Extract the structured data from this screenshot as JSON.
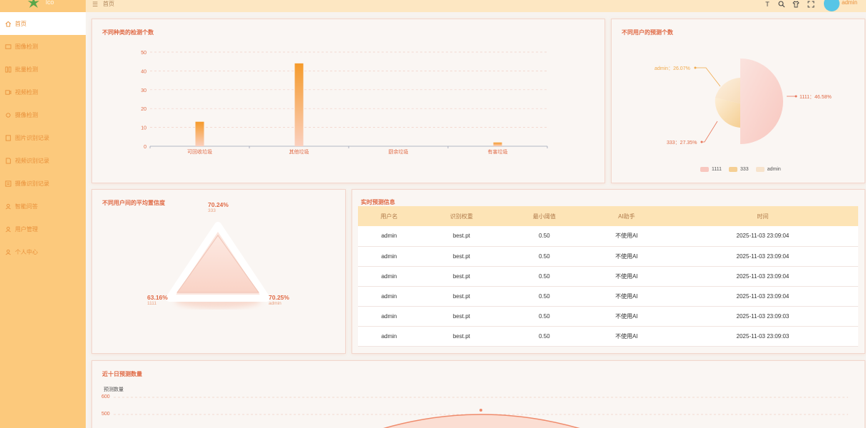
{
  "app": {
    "logo_text": "lco"
  },
  "sidebar": {
    "items": [
      {
        "label": "首页"
      },
      {
        "label": "图像检测"
      },
      {
        "label": "批量检测"
      },
      {
        "label": "视频检测"
      },
      {
        "label": "摄像检测"
      },
      {
        "label": "图片识别记录"
      },
      {
        "label": "视频识别记录"
      },
      {
        "label": "摄像识别记录"
      },
      {
        "label": "智能问答"
      },
      {
        "label": "用户管理"
      },
      {
        "label": "个人中心"
      }
    ]
  },
  "header": {
    "breadcrumb": "首页",
    "username": "admin",
    "icons": [
      "font-size-icon",
      "search-icon",
      "shirt-icon",
      "fullscreen-icon"
    ]
  },
  "colors": {
    "accent": "#e06a45",
    "sidebar": "#fcc97c",
    "header": "#fde7c2"
  },
  "panels": {
    "bar_title": "不同种类的检测个数",
    "pie_title": "不同用户的预测个数",
    "radar_title": "不同用户间的平均置信度",
    "table_title": "实时预测信息",
    "line_title": "近十日预测数量"
  },
  "chart_data": [
    {
      "type": "bar",
      "categories": [
        "可回收垃圾",
        "其他垃圾",
        "厨余垃圾",
        "有害垃圾"
      ],
      "values": [
        13,
        44,
        0,
        2
      ],
      "ylim": [
        0,
        50
      ],
      "yticks": [
        "0",
        "10",
        "20",
        "30",
        "40",
        "50"
      ],
      "grid": true
    },
    {
      "type": "pie",
      "slices": [
        {
          "name": "1111",
          "value": 46.58,
          "label": "1111：46.58%"
        },
        {
          "name": "333",
          "value": 27.35,
          "label": "333：27.35%"
        },
        {
          "name": "admin",
          "value": 26.07,
          "label": "admin：26.07%"
        }
      ],
      "legend": [
        "1111",
        "333",
        "admin"
      ],
      "legend_placement": "bottom"
    },
    {
      "type": "radar",
      "points": [
        {
          "name": "333",
          "value": "70.24%"
        },
        {
          "name": "1111",
          "value": "63.16%"
        },
        {
          "name": "admin",
          "value": "70.25%"
        }
      ]
    },
    {
      "type": "line",
      "ylabel": "预测数量",
      "yticks": [
        "600",
        "500"
      ],
      "grid": true
    }
  ],
  "table": {
    "headers": [
      "用户名",
      "识别权重",
      "最小阈值",
      "AI助手",
      "时间"
    ],
    "rows": [
      [
        "admin",
        "best.pt",
        "0.50",
        "不使用AI",
        "2025-11-03 23:09:04"
      ],
      [
        "admin",
        "best.pt",
        "0.50",
        "不使用AI",
        "2025-11-03 23:09:04"
      ],
      [
        "admin",
        "best.pt",
        "0.50",
        "不使用AI",
        "2025-11-03 23:09:04"
      ],
      [
        "admin",
        "best.pt",
        "0.50",
        "不使用AI",
        "2025-11-03 23:09:04"
      ],
      [
        "admin",
        "best.pt",
        "0.50",
        "不使用AI",
        "2025-11-03 23:09:03"
      ],
      [
        "admin",
        "best.pt",
        "0.50",
        "不使用AI",
        "2025-11-03 23:09:03"
      ]
    ]
  }
}
